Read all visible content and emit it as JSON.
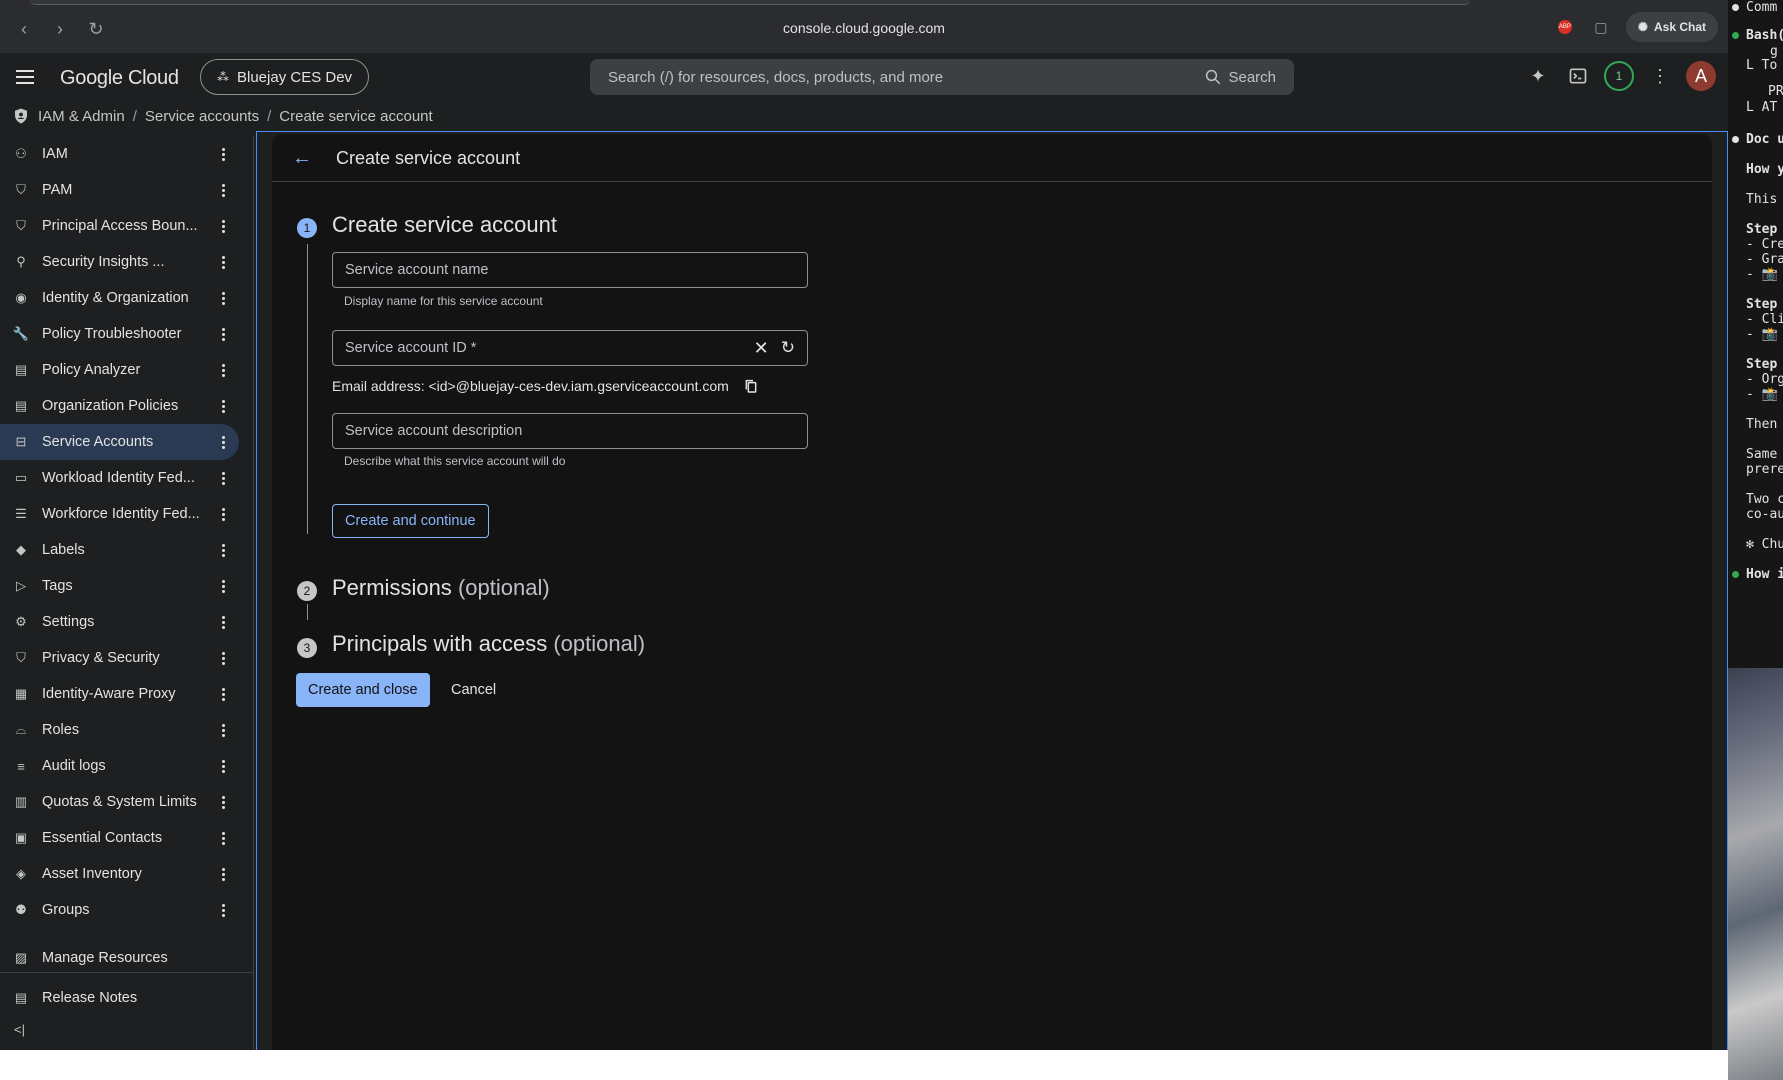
{
  "browser": {
    "url": "console.cloud.google.com",
    "ask_chat": "Ask Chat",
    "ext_badge": "ABP"
  },
  "header": {
    "logo": "Google Cloud",
    "project": "Bluejay CES Dev",
    "search_placeholder": "Search (/) for resources, docs, products, and more",
    "search_button": "Search",
    "notifications": "1",
    "avatar": "A"
  },
  "breadcrumb": [
    "IAM & Admin",
    "Service accounts",
    "Create service account"
  ],
  "sidebar": {
    "items": [
      {
        "label": "IAM",
        "icon": "person-add-icon"
      },
      {
        "label": "PAM",
        "icon": "shield-icon"
      },
      {
        "label": "Principal Access Boun...",
        "icon": "shield-search-icon"
      },
      {
        "label": "Security Insights ...",
        "icon": "person-search-icon"
      },
      {
        "label": "Identity & Organization",
        "icon": "account-circle-icon"
      },
      {
        "label": "Policy Troubleshooter",
        "icon": "wrench-icon"
      },
      {
        "label": "Policy Analyzer",
        "icon": "doc-search-icon"
      },
      {
        "label": "Organization Policies",
        "icon": "list-box-icon"
      },
      {
        "label": "Service Accounts",
        "icon": "service-account-icon"
      },
      {
        "label": "Workload Identity Fed...",
        "icon": "id-card-icon"
      },
      {
        "label": "Workforce Identity Fed...",
        "icon": "list-icon"
      },
      {
        "label": "Labels",
        "icon": "tag-icon"
      },
      {
        "label": "Tags",
        "icon": "label-arrow-icon"
      },
      {
        "label": "Settings",
        "icon": "gear-icon"
      },
      {
        "label": "Privacy & Security",
        "icon": "shield-lock-icon"
      },
      {
        "label": "Identity-Aware Proxy",
        "icon": "proxy-icon"
      },
      {
        "label": "Roles",
        "icon": "hat-icon"
      },
      {
        "label": "Audit logs",
        "icon": "lines-icon"
      },
      {
        "label": "Quotas & System Limits",
        "icon": "calculator-icon"
      },
      {
        "label": "Essential Contacts",
        "icon": "contact-icon"
      },
      {
        "label": "Asset Inventory",
        "icon": "diamond-icon"
      },
      {
        "label": "Groups",
        "icon": "group-icon"
      }
    ],
    "manage_resources": "Manage Resources",
    "release_notes": "Release Notes"
  },
  "page": {
    "title": "Create service account",
    "step1": {
      "num": "1",
      "title": "Create service account"
    },
    "name_placeholder": "Service account name",
    "name_hint": "Display name for this service account",
    "id_placeholder": "Service account ID *",
    "email_text": "Email address: <id>@bluejay-ces-dev.iam.gserviceaccount.com",
    "desc_placeholder": "Service account description",
    "desc_hint": "Describe what this service account will do",
    "create_continue": "Create and continue",
    "step2": {
      "num": "2",
      "title": "Permissions",
      "optional": "(optional)"
    },
    "step3": {
      "num": "3",
      "title": "Principals with access",
      "optional": "(optional)"
    },
    "create_close": "Create and close",
    "cancel": "Cancel"
  },
  "terminal": {
    "lines": [
      "Comm",
      "Bash(",
      "g",
      "L  To",
      "PR",
      "L  AT",
      "Doc u",
      "How y",
      "This",
      "Step",
      "- Cre",
      "- Gra",
      "- 📸",
      "Step",
      "- Cli",
      "- 📸",
      "Step",
      "- Org",
      "- 📸",
      "Then",
      "Same",
      "prere",
      "Two c",
      "co-au",
      "✻ Churn",
      "How i"
    ]
  },
  "colors": {
    "accent": "#8ab4f8",
    "active_nav": "#2a3a52",
    "background": "#131314"
  }
}
